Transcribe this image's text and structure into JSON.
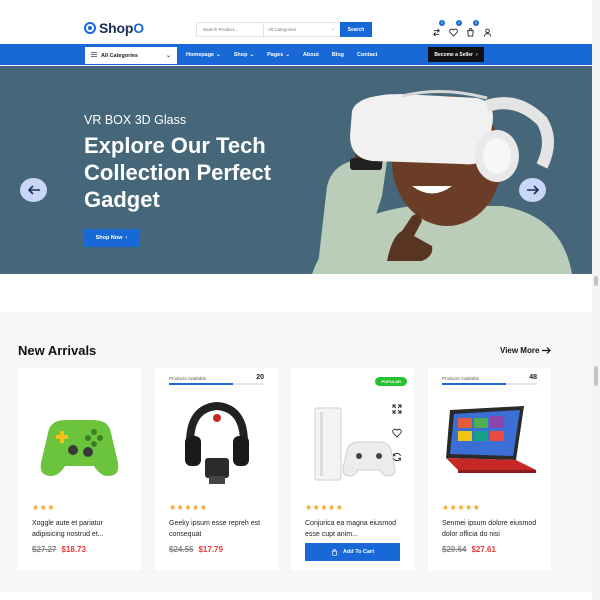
{
  "header": {
    "logo_text_main": "Shop",
    "logo_text_accent": "O",
    "search_placeholder": "Search Product...",
    "search_category": "All Categories",
    "search_button": "Search",
    "icon_badges": [
      "0",
      "1",
      "0"
    ]
  },
  "nav": {
    "category_dropdown": "All Categories",
    "items": [
      {
        "label": "Homepage",
        "has_dropdown": true
      },
      {
        "label": "Shop",
        "has_dropdown": true
      },
      {
        "label": "Pages",
        "has_dropdown": true
      },
      {
        "label": "About",
        "has_dropdown": false
      },
      {
        "label": "Blog",
        "has_dropdown": false
      },
      {
        "label": "Contact",
        "has_dropdown": false
      }
    ],
    "seller_button": "Become a Seller",
    "seller_arrow": "›"
  },
  "hero": {
    "subtitle": "VR BOX 3D Glass",
    "title": "Explore Our Tech Collection Perfect Gadget",
    "button": "Shop Now",
    "button_arrow": "›",
    "bg_color": "#456779"
  },
  "section": {
    "title": "New Arrivals",
    "view_more": "View More"
  },
  "products": [
    {
      "stars": "★★★",
      "name": "Xoggle aute et pariatur adipisicing nostrud et...",
      "old_price": "$27.27",
      "new_price": "$18.73",
      "image": "green-game-controller"
    },
    {
      "availability_label": "Products Available",
      "availability_count": "20",
      "availability_fraction": 0.67,
      "stars": "★★★★★",
      "name": "Geeky ipsum esse repreh est consequat",
      "old_price": "$24.55",
      "new_price": "$17.79",
      "image": "gaming-headset"
    },
    {
      "badge": "POPULAR",
      "stars": "★★★★★",
      "name": "Conjurica ea magna eiusmod esse cupt anim...",
      "add_to_cart": "Add To Cart",
      "image": "game-console-white"
    },
    {
      "availability_label": "Products Available",
      "availability_count": "48",
      "availability_fraction": 0.67,
      "stars": "★★★★★",
      "name": "Senmei ipsum dolore eiusmod dolor officia do nisi",
      "old_price": "$20.64",
      "new_price": "$27.61",
      "image": "red-laptop"
    }
  ],
  "colors": {
    "brand": "#1868d8",
    "price_new": "#e53935",
    "stars": "#f5a623",
    "badge_popular": "#27c22f"
  }
}
